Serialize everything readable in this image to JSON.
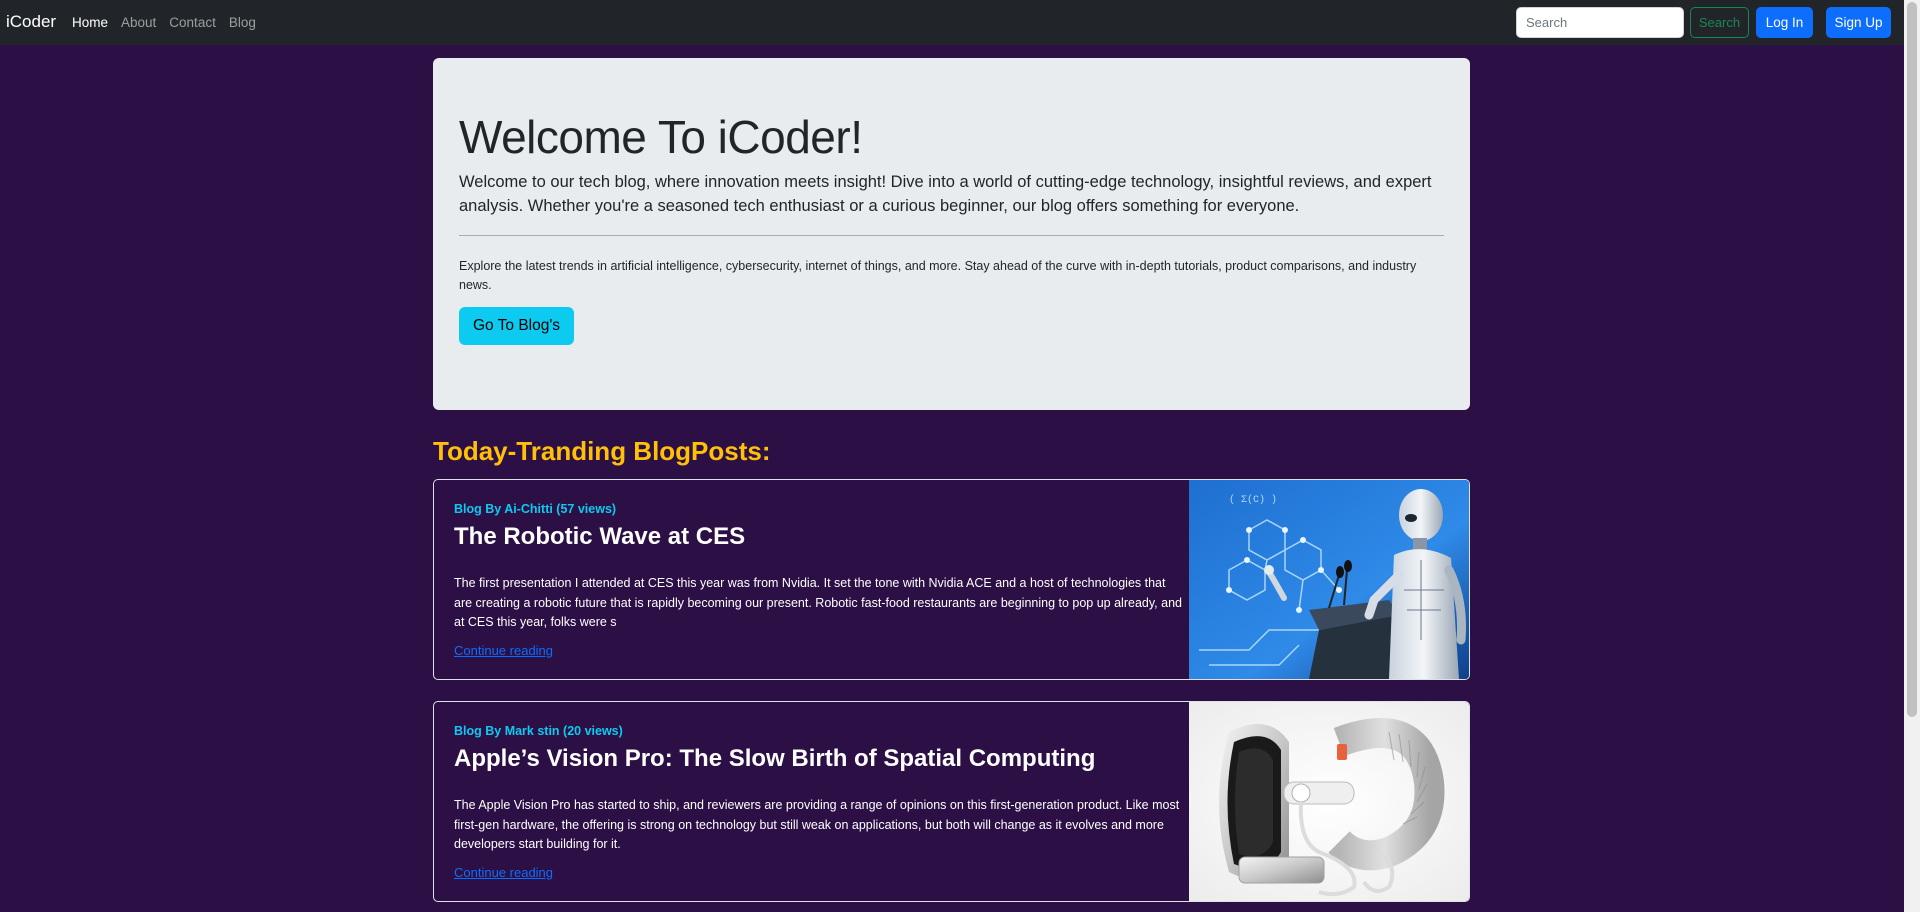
{
  "navbar": {
    "brand": "iCoder",
    "links": [
      {
        "label": "Home",
        "active": true
      },
      {
        "label": "About",
        "active": false
      },
      {
        "label": "Contact",
        "active": false
      },
      {
        "label": "Blog",
        "active": false
      }
    ],
    "search_placeholder": "Search",
    "search_button": "Search",
    "login_button": "Log In",
    "signup_button": "Sign Up"
  },
  "jumbotron": {
    "title": "Welcome To iCoder!",
    "lead": "Welcome to our tech blog, where innovation meets insight! Dive into a world of cutting-edge technology, insightful reviews, and expert analysis. Whether you're a seasoned tech enthusiast or a curious beginner, our blog offers something for everyone.",
    "text": "Explore the latest trends in artificial intelligence, cybersecurity, internet of things, and more. Stay ahead of the curve with in-depth tutorials, product comparisons, and industry news.",
    "button": "Go To Blog's"
  },
  "section_title": "Today-Tranding BlogPosts:",
  "posts": [
    {
      "author": "Blog By Ai-Chitti (57 views)",
      "title": "The Robotic Wave at CES",
      "excerpt": "The first presentation I attended at CES this year was from Nvidia. It set the tone with Nvidia ACE and a host of technologies that are creating a robotic future that is rapidly becoming our present. Robotic fast-food restaurants are beginning to pop up already, and at CES this year, folks were s",
      "link": "Continue reading"
    },
    {
      "author": "Blog By Mark stin (20 views)",
      "title": "Apple’s Vision Pro: The Slow Birth of Spatial Computing",
      "excerpt": "The Apple Vision Pro has started to ship, and reviewers are providing a range of opinions on this first-generation product. Like most first-gen hardware, the offering is strong on technology but still weak on applications, but both will change as it evolves and more developers start building for it.",
      "link": "Continue reading"
    }
  ],
  "colors": {
    "page_bg": "#2b0f45",
    "navbar_bg": "#212529",
    "accent_yellow": "#ffc107",
    "accent_cyan": "#0dcaf0",
    "primary_blue": "#0d6efd",
    "success_green": "#198754"
  }
}
